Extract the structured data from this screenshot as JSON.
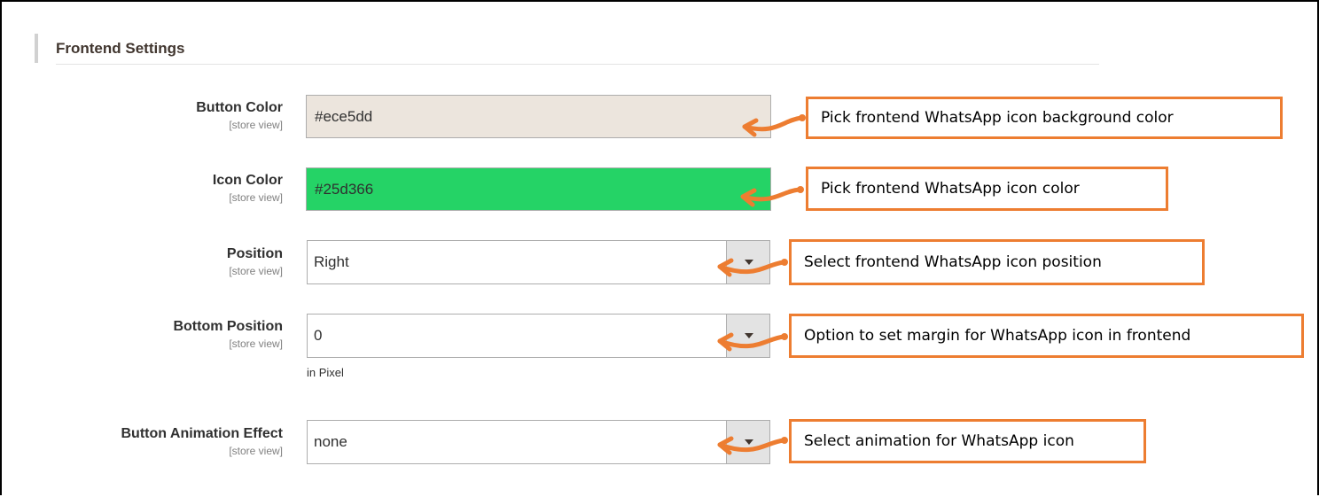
{
  "section": {
    "title": "Frontend Settings"
  },
  "fields": {
    "button_color": {
      "label": "Button Color",
      "scope": "[store view]",
      "value": "#ece5dd",
      "background": "#ece5dd"
    },
    "icon_color": {
      "label": "Icon Color",
      "scope": "[store view]",
      "value": "#25d366",
      "background": "#25d366"
    },
    "position": {
      "label": "Position",
      "scope": "[store view]",
      "value": "Right"
    },
    "bottom_position": {
      "label": "Bottom Position",
      "scope": "[store view]",
      "value": "0",
      "hint": "in Pixel"
    },
    "animation": {
      "label": "Button Animation Effect",
      "scope": "[store view]",
      "value": "none"
    }
  },
  "callouts": {
    "button_color": "Pick frontend WhatsApp icon background color",
    "icon_color": "Pick frontend WhatsApp icon color",
    "position": "Select frontend WhatsApp icon position",
    "bottom_position": "Option to set margin for WhatsApp icon in frontend",
    "animation": "Select animation for WhatsApp icon"
  },
  "colors": {
    "callout_border": "#ed7d31",
    "arrow": "#ed7d31"
  },
  "icons": {
    "select_arrow": "chevron-down-icon",
    "callout_arrow": "curved-arrow-icon"
  }
}
